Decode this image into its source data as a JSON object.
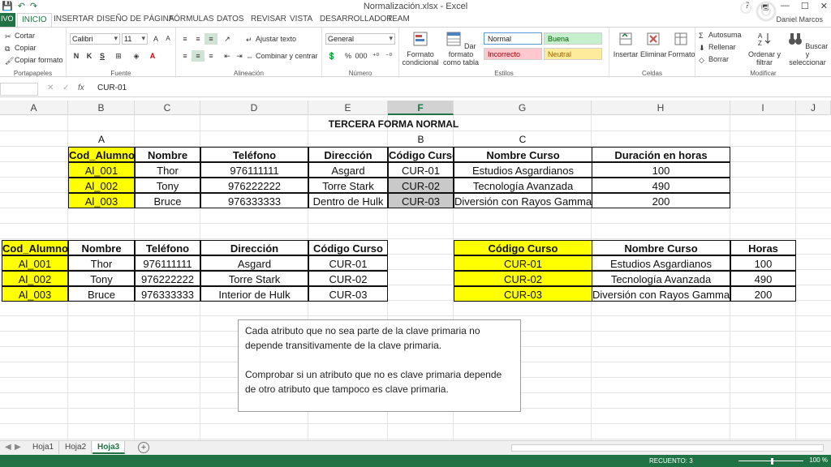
{
  "window": {
    "title": "Normalización.xlsx - Excel",
    "user": "Daniel Marcos"
  },
  "qat": {
    "save": "💾",
    "undo": "↶",
    "redo": "↷"
  },
  "tabs": [
    "INICIO",
    "INSERTAR",
    "DISEÑO DE PÁGINA",
    "FÓRMULAS",
    "DATOS",
    "REVISAR",
    "VISTA",
    "DESARROLLADOR",
    "TEAM"
  ],
  "file_tab": "IVO",
  "ribbon": {
    "clipboard": {
      "cut": "Cortar",
      "copy": "Copiar",
      "format_painter": "Copiar formato",
      "label": "Portapapeles"
    },
    "font": {
      "name": "Calibri",
      "size": "11",
      "bold": "N",
      "italic": "K",
      "underline": "S",
      "label": "Fuente"
    },
    "alignment": {
      "wrap": "Ajustar texto",
      "merge": "Combinar y centrar",
      "label": "Alineación"
    },
    "number": {
      "format": "General",
      "label": "Número"
    },
    "styles": {
      "cond_format": "Formato condicional",
      "table_format": "Dar formato como tabla",
      "normal": "Normal",
      "good": "Buena",
      "bad": "Incorrecto",
      "neutral": "Neutral",
      "label": "Estilos"
    },
    "cells": {
      "insert": "Insertar",
      "delete": "Eliminar",
      "format": "Formato",
      "label": "Celdas"
    },
    "editing": {
      "autosum": "Autosuma",
      "fill": "Rellenar",
      "clear": "Borrar",
      "sort": "Ordenar y filtrar",
      "find": "Buscar y seleccionar",
      "label": "Modificar"
    }
  },
  "formula_bar": {
    "name_box": "",
    "value": "CUR-01",
    "fx": "fx"
  },
  "columns": [
    "A",
    "B",
    "C",
    "D",
    "E",
    "F",
    "G",
    "H",
    "I",
    "J"
  ],
  "sheet": {
    "title": "TERCERA FORMA NORMAL",
    "group_labels": {
      "a": "A",
      "b": "B",
      "c": "C"
    },
    "table1": {
      "headers": [
        "Cod_Alumno",
        "Nombre",
        "Teléfono",
        "Dirección",
        "Código Curso",
        "Nombre Curso",
        "Duración en horas"
      ],
      "rows": [
        [
          "Al_001",
          "Thor",
          "976111111",
          "Asgard",
          "CUR-01",
          "Estudios Asgardianos",
          "100"
        ],
        [
          "Al_002",
          "Tony",
          "976222222",
          "Torre Stark",
          "CUR-02",
          "Tecnología Avanzada",
          "490"
        ],
        [
          "Al_003",
          "Bruce",
          "976333333",
          "Dentro de Hulk",
          "CUR-03",
          "Diversión con Rayos Gamma",
          "200"
        ]
      ]
    },
    "table2": {
      "headers": [
        "Cod_Alumno",
        "Nombre",
        "Teléfono",
        "Dirección",
        "Código Curso"
      ],
      "rows": [
        [
          "Al_001",
          "Thor",
          "976111111",
          "Asgard",
          "CUR-01"
        ],
        [
          "Al_002",
          "Tony",
          "976222222",
          "Torre Stark",
          "CUR-02"
        ],
        [
          "Al_003",
          "Bruce",
          "976333333",
          "Interior de Hulk",
          "CUR-03"
        ]
      ]
    },
    "table3": {
      "headers": [
        "Código Curso",
        "Nombre Curso",
        "Horas"
      ],
      "rows": [
        [
          "CUR-01",
          "Estudios Asgardianos",
          "100"
        ],
        [
          "CUR-02",
          "Tecnología Avanzada",
          "490"
        ],
        [
          "CUR-03",
          "Diversión con Rayos Gamma",
          "200"
        ]
      ]
    },
    "note": {
      "p1": "Cada atributo que no sea parte de la clave primaria no depende transitivamente de la clave primaria.",
      "p2": "Comprobar si un atributo que no es clave primaria depende de otro atributo que tampoco es clave primaria."
    }
  },
  "sheet_tabs": [
    "Hoja1",
    "Hoja2",
    "Hoja3"
  ],
  "active_sheet": "Hoja3",
  "status": {
    "count": "RECUENTO: 3",
    "zoom": "100 %"
  },
  "colors": {
    "excel_green": "#217346",
    "yellow": "#ffff00",
    "selected_grey": "#c9c9c9"
  }
}
